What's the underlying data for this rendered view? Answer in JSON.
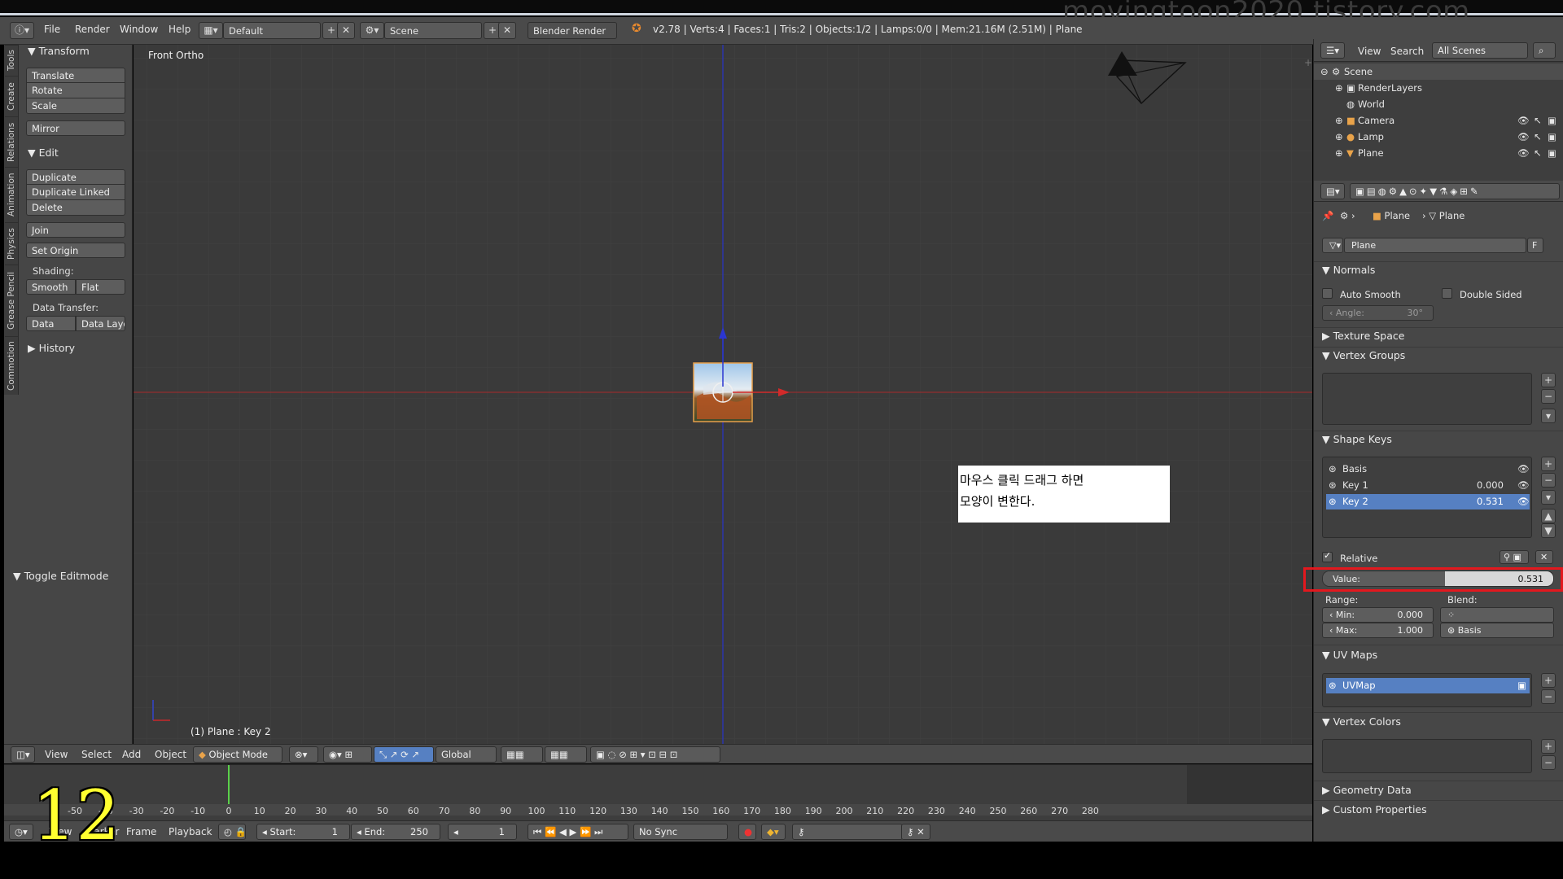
{
  "watermark": "movingtoon2020.tistory.com",
  "menu": {
    "file": "File",
    "render": "Render",
    "window": "Window",
    "help": "Help"
  },
  "header": {
    "layout": "Default",
    "scene": "Scene",
    "engine": "Blender Render",
    "stats": "v2.78 | Verts:4 | Faces:1 | Tris:2 | Objects:1/2 | Lamps:0/0 | Mem:21.16M (2.51M) | Plane"
  },
  "tool_tabs": [
    "Tools",
    "Create",
    "Relations",
    "Animation",
    "Physics",
    "Grease Pencil",
    "Commotion"
  ],
  "tools": {
    "transform_header": "Transform",
    "translate": "Translate",
    "rotate": "Rotate",
    "scale": "Scale",
    "mirror": "Mirror",
    "edit_header": "Edit",
    "duplicate": "Duplicate",
    "duplicate_linked": "Duplicate Linked",
    "delete": "Delete",
    "join": "Join",
    "set_origin": "Set Origin",
    "shading_label": "Shading:",
    "smooth": "Smooth",
    "flat": "Flat",
    "data_transfer_label": "Data Transfer:",
    "data": "Data",
    "data_layout": "Data Layo",
    "history_header": "History",
    "toggle_editmode": "Toggle Editmode"
  },
  "viewport": {
    "title": "Front Ortho",
    "status": "(1) Plane : Key 2",
    "note_line1": "마우스 클릭 드래그 하면",
    "note_line2": "모양이 변한다."
  },
  "viewport_footer": {
    "view": "View",
    "select": "Select",
    "add": "Add",
    "object": "Object",
    "mode": "Object Mode",
    "orientation": "Global"
  },
  "timeline": {
    "ticks": [
      "-50",
      "-40",
      "-30",
      "-20",
      "-10",
      "0",
      "10",
      "20",
      "30",
      "40",
      "50",
      "60",
      "70",
      "80",
      "90",
      "100",
      "110",
      "120",
      "130",
      "140",
      "150",
      "160",
      "170",
      "180",
      "190",
      "200",
      "210",
      "220",
      "230",
      "240",
      "250",
      "260",
      "270",
      "280"
    ],
    "current_frame": 1,
    "view": "View",
    "marker": "Marker",
    "frame": "Frame",
    "playback": "Playback",
    "start_label": "Start:",
    "start_value": "1",
    "end_label": "End:",
    "end_value": "250",
    "frame_value": "1",
    "sync": "No Sync"
  },
  "overlay_number": "12",
  "outliner": {
    "view": "View",
    "search": "Search",
    "filter": "All Scenes",
    "items": [
      "Scene",
      "RenderLayers",
      "World",
      "Camera",
      "Lamp",
      "Plane"
    ]
  },
  "properties": {
    "breadcrumb_object": "Plane",
    "breadcrumb_mesh": "Plane",
    "mesh_name": "Plane",
    "fake_user": "F",
    "normals": "Normals",
    "auto_smooth": "Auto Smooth",
    "double_sided": "Double Sided",
    "angle_label": "Angle:",
    "angle_value": "30°",
    "texture_space": "Texture Space",
    "vertex_groups": "Vertex Groups",
    "shape_keys": "Shape Keys",
    "keys": [
      {
        "name": "Basis",
        "value": ""
      },
      {
        "name": "Key 1",
        "value": "0.000"
      },
      {
        "name": "Key 2",
        "value": "0.531"
      }
    ],
    "relative": "Relative",
    "value_label": "Value:",
    "value": "0.531",
    "value_fraction": 0.531,
    "range_label": "Range:",
    "blend_label": "Blend:",
    "min_label": "Min:",
    "min_value": "0.000",
    "max_label": "Max:",
    "max_value": "1.000",
    "relative_key": "Basis",
    "uv_maps": "UV Maps",
    "uv_map_name": "UVMap",
    "vertex_colors": "Vertex Colors",
    "geometry_data": "Geometry Data",
    "custom_properties": "Custom Properties"
  },
  "colors": {
    "accent": "#5680c2",
    "highlight": "#e3181e",
    "x_axis": "#c8272a",
    "z_axis": "#2233c8"
  }
}
